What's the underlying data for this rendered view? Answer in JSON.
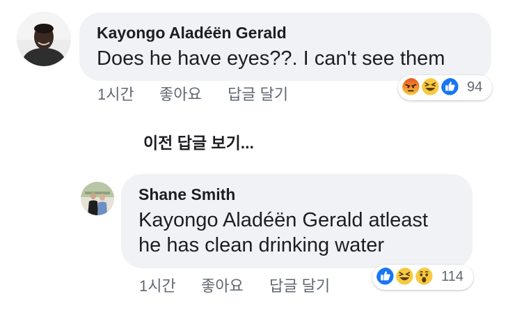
{
  "comment": {
    "author": "Kayongo Aladéën Gerald",
    "text": "Does he have eyes??. I can't see them",
    "time": "1시간",
    "like_label": "좋아요",
    "reply_label": "답글 달기",
    "reaction_count": "94",
    "reactions": [
      "angry-icon",
      "laugh-icon",
      "like-icon"
    ]
  },
  "view_previous_label": "이전 답글 보기...",
  "reply": {
    "author": "Shane Smith",
    "text_line1": "Kayongo Aladéën Gerald atleast",
    "text_line2": "he has clean drinking water",
    "time": "1시간",
    "like_label": "좋아요",
    "reply_label": "답글 달기",
    "reaction_count": "114",
    "reactions": [
      "like-icon",
      "laugh-icon",
      "wow-icon"
    ]
  },
  "colors": {
    "bubble": "#f0f2f5",
    "like_blue": "#1877f2",
    "emoji_yellow": "#f7c941",
    "angry_orange": "#f0663c",
    "meta_gray": "#606770"
  }
}
